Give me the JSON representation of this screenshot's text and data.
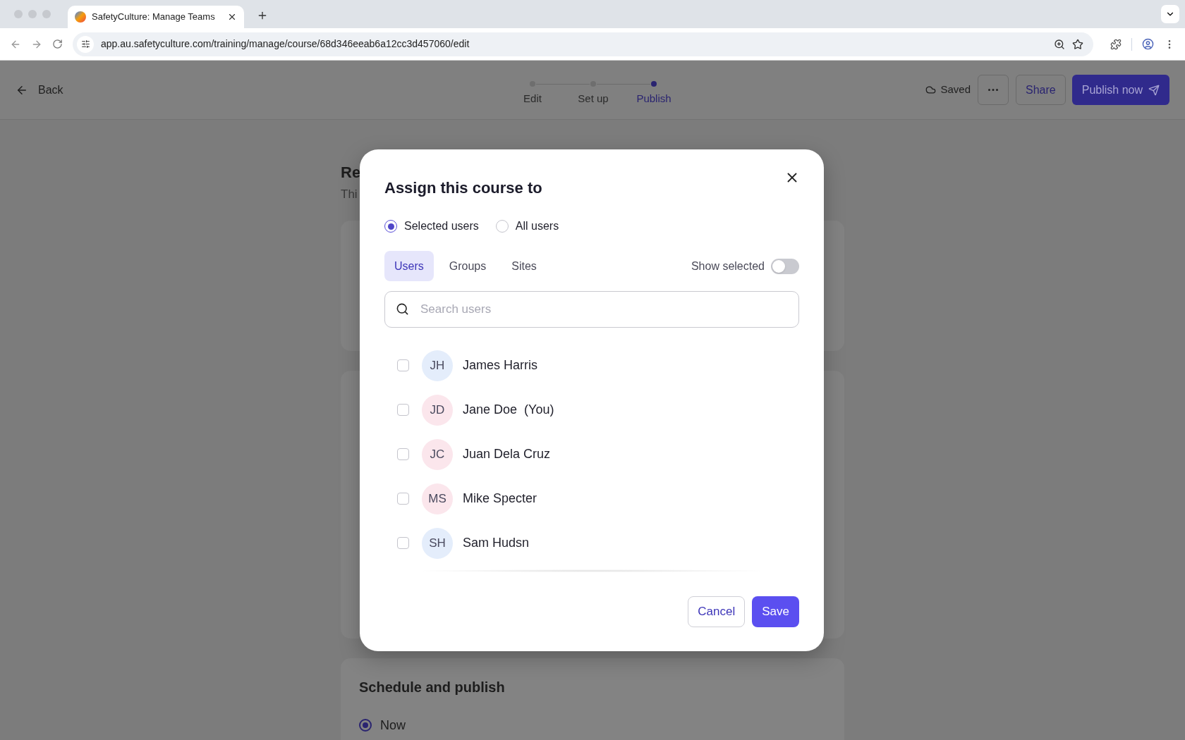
{
  "browser": {
    "tab_title": "SafetyCulture: Manage Teams",
    "url": "app.au.safetyculture.com/training/manage/course/68d346eeab6a12cc3d457060/edit"
  },
  "header": {
    "back": "Back",
    "steps": [
      {
        "label": "Edit",
        "selected": false
      },
      {
        "label": "Set up",
        "selected": false
      },
      {
        "label": "Publish",
        "selected": true
      }
    ],
    "status": "Saved",
    "share": "Share",
    "publish": "Publish now"
  },
  "page": {
    "heading": "Re",
    "subtitle": "Thi",
    "schedule_title": "Schedule and publish",
    "schedule_options": [
      {
        "label": "Now",
        "selected": true
      }
    ]
  },
  "dialog": {
    "title": "Assign this course to",
    "audience": [
      {
        "label": "Selected users",
        "selected": true
      },
      {
        "label": "All users",
        "selected": false
      }
    ],
    "tabs": [
      {
        "label": "Users",
        "selected": true
      },
      {
        "label": "Groups",
        "selected": false
      },
      {
        "label": "Sites",
        "selected": false
      }
    ],
    "show_selected": {
      "label": "Show selected",
      "on": false
    },
    "search": {
      "placeholder": "Search users"
    },
    "users": [
      {
        "initials": "JH",
        "name": "James Harris",
        "color": "#e4edfb",
        "checked": false
      },
      {
        "initials": "JD",
        "name": "Jane Doe  (You)",
        "color": "#fbe6ec",
        "checked": false
      },
      {
        "initials": "JC",
        "name": "Juan Dela Cruz",
        "color": "#fbe6ec",
        "checked": false
      },
      {
        "initials": "MS",
        "name": "Mike Specter",
        "color": "#fbe6ec",
        "checked": false
      },
      {
        "initials": "SH",
        "name": "Sam Hudsn",
        "color": "#e4edfb",
        "checked": false
      }
    ],
    "cancel": "Cancel",
    "save": "Save"
  }
}
